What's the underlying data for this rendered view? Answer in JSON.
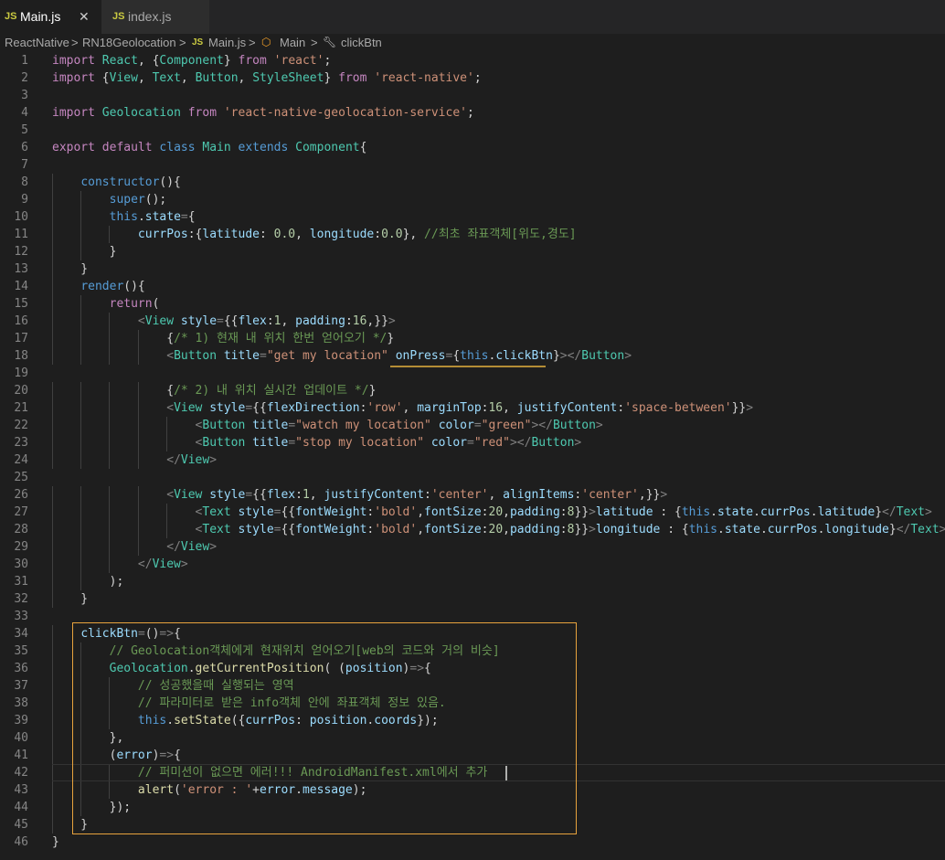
{
  "tabs": [
    {
      "icon": "JS",
      "label": "Main.js",
      "active": true,
      "close": "✕"
    },
    {
      "icon": "JS",
      "label": "index.js",
      "active": false
    }
  ],
  "breadcrumb": {
    "items": [
      "ReactNative",
      "RN18Geolocation",
      "Main.js",
      "Main",
      "clickBtn"
    ],
    "separator": ">"
  },
  "editor": {
    "line_numbers": [
      "1",
      "2",
      "3",
      "4",
      "5",
      "6",
      "7",
      "8",
      "9",
      "10",
      "11",
      "12",
      "13",
      "14",
      "15",
      "16",
      "17",
      "18",
      "19",
      "20",
      "21",
      "22",
      "23",
      "24",
      "25",
      "26",
      "27",
      "28",
      "29",
      "30",
      "31",
      "32",
      "33",
      "34",
      "35",
      "36",
      "37",
      "38",
      "39",
      "40",
      "41",
      "42",
      "43",
      "44",
      "45",
      "46"
    ],
    "lines": [
      "import React, {Component} from 'react';",
      "import {View, Text, Button, StyleSheet} from 'react-native';",
      "",
      "import Geolocation from 'react-native-geolocation-service';",
      "",
      "export default class Main extends Component{",
      "",
      "    constructor(){",
      "        super();",
      "        this.state={",
      "            currPos:{latitude: 0.0, longitude:0.0}, //최초 좌표객체[위도,경도]",
      "        }",
      "    }",
      "    render(){",
      "        return(",
      "            <View style={{flex:1, padding:16,}}>",
      "                {/* 1) 현재 내 위치 한번 얻어오기 */}",
      "                <Button title=\"get my location\" onPress={this.clickBtn}></Button>",
      "",
      "                {/* 2) 내 위치 실시간 업데이트 */}",
      "                <View style={{flexDirection:'row', marginTop:16, justifyContent:'space-between'}}>",
      "                    <Button title=\"watch my location\" color=\"green\"></Button>",
      "                    <Button title=\"stop my location\" color=\"red\"></Button>",
      "                </View>",
      "",
      "                <View style={{flex:1, justifyContent:'center', alignItems:'center',}}>",
      "                    <Text style={{fontWeight:'bold',fontSize:20,padding:8}}>latitude : {this.state.currPos.latitude}</Text>",
      "                    <Text style={{fontWeight:'bold',fontSize:20,padding:8}}>longitude : {this.state.currPos.longitude}</Text>",
      "                </View>",
      "            </View>",
      "        );",
      "    }",
      "",
      "    clickBtn=()=>{",
      "        // Geolocation객체에게 현재위치 얻어오기[web의 코드와 거의 비슷]",
      "        Geolocation.getCurrentPosition( (position)=>{",
      "            // 성공했을때 실행되는 영역",
      "            // 파라미터로 받은 info객체 안에 좌표객체 정보 있음.",
      "            this.setState({currPos: position.coords});",
      "        },",
      "        (error)=>{",
      "            // 퍼미션이 없으면 에러!!! AndroidManifest.xml에서 추가",
      "            alert('error : '+error.message);",
      "        });",
      "    }",
      "}"
    ]
  },
  "colors": {
    "background": "#1e1e1e",
    "keyword": "#569cd6",
    "control": "#c586c0",
    "string": "#ce9178",
    "variable": "#9cdcfe",
    "function": "#dcdcaa",
    "class": "#4ec9b0",
    "comment": "#6a9955",
    "highlight_border": "#e8a33d"
  }
}
